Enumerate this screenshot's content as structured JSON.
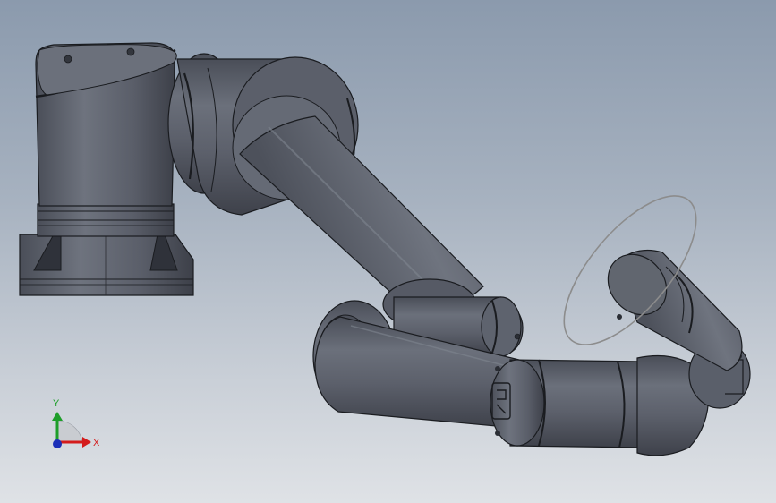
{
  "viewport": {
    "background_top": "#8b9aad",
    "background_bottom": "#dfe2e6",
    "model_color": "#5e636e",
    "model_dark": "#3c4049",
    "model_light": "#7c818b",
    "outline": "#1a1c20",
    "rotation_ring_color": "#8c8c8c"
  },
  "triad": {
    "x_label": "X",
    "y_label": "Y",
    "x_color": "#d41c1c",
    "y_color": "#1e9e2a",
    "z_color": "#1b2fb8"
  },
  "model": {
    "parts": [
      "base",
      "shoulder",
      "upper-arm",
      "elbow",
      "forearm",
      "wrist-1",
      "wrist-2",
      "tool-flange"
    ],
    "logo_icon": "ur-logo-icon"
  }
}
